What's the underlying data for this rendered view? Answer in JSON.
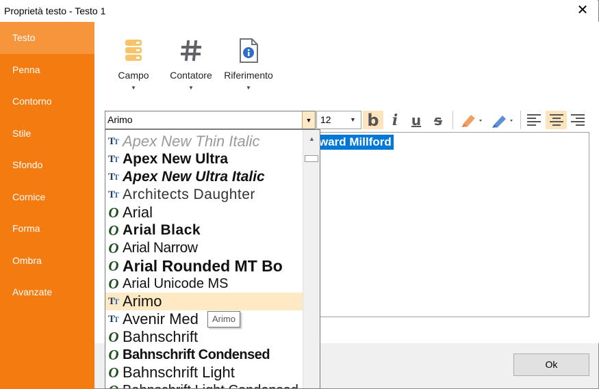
{
  "window": {
    "title": "Proprietà testo - Testo 1",
    "close_glyph": "✕"
  },
  "sidebar": {
    "items": [
      {
        "label": "Testo",
        "active": true
      },
      {
        "label": "Penna"
      },
      {
        "label": "Contorno"
      },
      {
        "label": "Stile"
      },
      {
        "label": "Sfondo"
      },
      {
        "label": "Cornice"
      },
      {
        "label": "Forma"
      },
      {
        "label": "Ombra"
      },
      {
        "label": "Avanzate"
      }
    ]
  },
  "ribbon": {
    "campo": {
      "label": "Campo",
      "icon": "field-stack-icon"
    },
    "contatore": {
      "label": "Contatore",
      "icon": "hash-icon"
    },
    "riferimento": {
      "label": "Riferimento",
      "icon": "document-info-icon"
    }
  },
  "toolbar": {
    "font_value": "Arimo",
    "size_value": "12",
    "buttons": [
      "bold",
      "italic",
      "underline",
      "strikethrough",
      "highlight-color",
      "text-color",
      "align-left",
      "align-center",
      "align-right"
    ]
  },
  "editor": {
    "selected_text": "ward Millford"
  },
  "font_list": {
    "items": [
      {
        "name": "Apex New Thin Italic",
        "type": "truetype"
      },
      {
        "name": "Apex New Ultra",
        "type": "truetype"
      },
      {
        "name": "Apex New Ultra Italic",
        "type": "truetype"
      },
      {
        "name": "Architects Daughter",
        "type": "truetype"
      },
      {
        "name": "Arial",
        "type": "opentype"
      },
      {
        "name": "Arial Black",
        "type": "opentype"
      },
      {
        "name": "Arial Narrow",
        "type": "opentype"
      },
      {
        "name": "Arial Rounded MT Bo",
        "type": "opentype"
      },
      {
        "name": "Arial Unicode MS",
        "type": "opentype"
      },
      {
        "name": "Arimo",
        "type": "truetype",
        "selected": true
      },
      {
        "name": "Avenir Med",
        "type": "truetype"
      },
      {
        "name": "Bahnschrift",
        "type": "opentype"
      },
      {
        "name": "Bahnschrift Condensed",
        "type": "opentype"
      },
      {
        "name": "Bahnschrift Light",
        "type": "opentype"
      },
      {
        "name": "Bahnschrift Light Condensed",
        "type": "opentype"
      }
    ],
    "tooltip": "Arimo"
  },
  "footer": {
    "ok_label": "Ok"
  },
  "colors": {
    "accent": "#f47b0f",
    "accent_active": "#f6953b",
    "selection": "#0078d7",
    "hover": "#fde9c4"
  }
}
